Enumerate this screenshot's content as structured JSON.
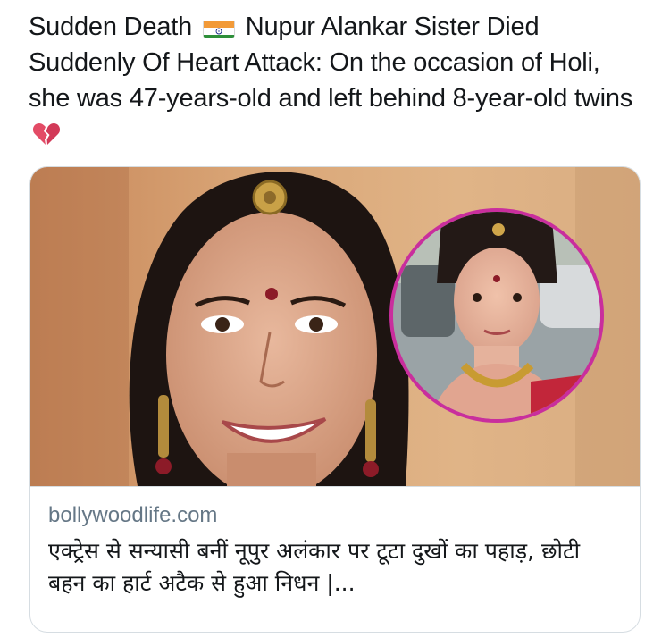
{
  "tweet": {
    "text_part1": "Sudden Death",
    "text_part2": "Nupur Alankar Sister Died Suddenly Of Heart Attack: On the occasion of Holi, she was 47-years-old and left behind 8-year-old twins",
    "flag_icon": "india-flag-icon",
    "emoji_icon": "broken-heart-icon"
  },
  "card": {
    "domain": "bollywoodlife.com",
    "title": "एक्ट्रेस से सन्यासी बनीं नूपुर अलंकार पर टूटा दुखों का पहाड़, छोटी बहन का हार्ट अटैक से हुआ निधन |...",
    "image": "photo-collage-woman-with-inset-portrait"
  },
  "colors": {
    "text": "#14171a",
    "secondary_text": "#657786",
    "border": "#d6dde2",
    "inset_ring": "#c92e9d"
  }
}
